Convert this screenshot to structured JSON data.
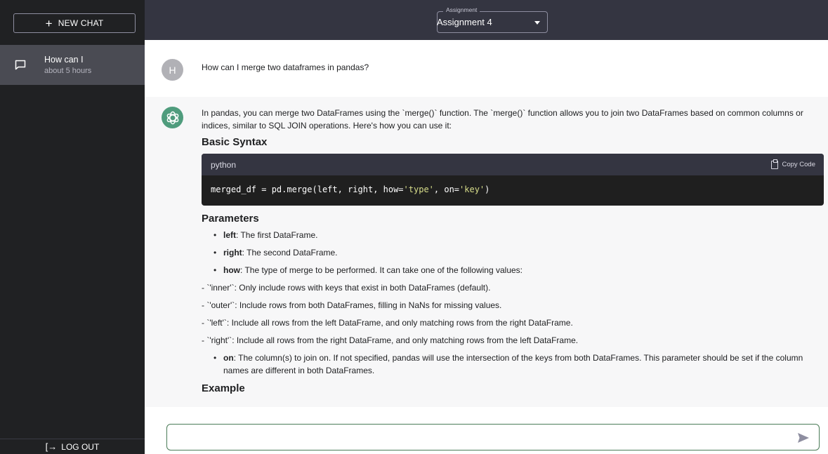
{
  "app": {
    "accent": "#4f9c7d",
    "sidebar_bg": "#202123",
    "topbar_bg": "#343541"
  },
  "sidebar": {
    "new_chat_label": "NEW CHAT",
    "chats": [
      {
        "title": "How can I",
        "time": "about 5 hours"
      }
    ],
    "logout_label": "LOG OUT"
  },
  "header": {
    "assignment_label": "Assignment",
    "assignment_value": "Assignment 4"
  },
  "conversation": {
    "user_initial": "H",
    "user_message": "How can I merge two dataframes in pandas?",
    "bot": {
      "intro": "In pandas, you can merge two DataFrames using the `merge()` function. The `merge()` function allows you to join two DataFrames based on common columns or indices, similar to SQL JOIN operations. Here's how you can use it:",
      "basic_syntax_heading": "Basic Syntax",
      "code_lang": "python",
      "copy_label": "Copy Code",
      "code": {
        "pre": "merged_df = pd.merge(left, right, how=",
        "str1": "'type'",
        "mid": ", on=",
        "str2": "'key'",
        "post": ")"
      },
      "parameters_heading": "Parameters",
      "params": [
        {
          "name": "left",
          "desc": ": The first DataFrame."
        },
        {
          "name": "right",
          "desc": ": The second DataFrame."
        },
        {
          "name": "how",
          "desc": ": The type of merge to be performed. It can take one of the following values:"
        }
      ],
      "how_values": [
        "- `'inner'`: Only include rows with keys that exist in both DataFrames (default).",
        "- `'outer'`: Include rows from both DataFrames, filling in NaNs for missing values.",
        "- `'left'`: Include all rows from the left DataFrame, and only matching rows from the right DataFrame.",
        "- `'right'`: Include all rows from the right DataFrame, and only matching rows from the left DataFrame."
      ],
      "on_param": {
        "name": "on",
        "desc": ": The column(s) to join on. If not specified, pandas will use the intersection of the keys from both DataFrames. This parameter should be set if the column names are different in both DataFrames."
      },
      "example_heading": "Example"
    }
  },
  "composer": {
    "value": "",
    "placeholder": ""
  }
}
